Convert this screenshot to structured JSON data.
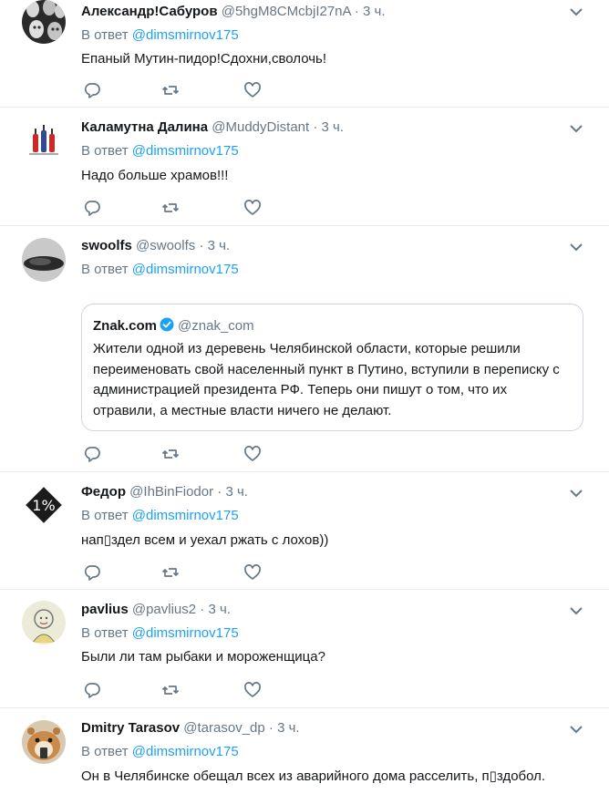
{
  "reply_prefix": "В ответ",
  "reply_target": "@dimsmirnov175",
  "colors": {
    "link": "#1da1f2",
    "secondary": "#657786",
    "border": "#e6ecf0",
    "verified": "#1da1f2"
  },
  "tweets": [
    {
      "name": "Александр!Сабуров",
      "handle": "@5hgM8CMcbjI27nA",
      "time": "3 ч.",
      "text": "Епаный Мутин-пидор!Сдохни,сволочь!"
    },
    {
      "name": "Каламутна Далина",
      "handle": "@MuddyDistant",
      "time": "3 ч.",
      "text": "Надо больше храмов!!!"
    },
    {
      "name": "swoolfs",
      "handle": "@swoolfs",
      "time": "3 ч.",
      "text": "",
      "quote": {
        "name": "Znak.com",
        "handle": "@znak_com",
        "verified": true,
        "text": "Жители одной из деревень Челябинской области, которые решили\nпереименовать свой населенный пункт в Путино, вступили в переписку с\nадминистрацией президента РФ. Теперь они пишут о том, что их\nотравили, а местные власти ничего не делают."
      }
    },
    {
      "name": "Федор",
      "handle": "@IhBinFiodor",
      "time": "3 ч.",
      "text": "нап▯здел всем и уехал ржать с лохов))"
    },
    {
      "name": "pavlius",
      "handle": "@pavlius2",
      "time": "3 ч.",
      "text": "Были ли там рыбаки и мороженщица?"
    },
    {
      "name": "Dmitry Tarasov",
      "handle": "@tarasov_dp",
      "time": "3 ч.",
      "text": "Он в Челябинске обещал всех из аварийного дома расселить, п▯здобол."
    }
  ],
  "icons": {
    "menu": "chevron-down-icon",
    "reply": "reply-icon",
    "retweet": "retweet-icon",
    "like": "like-icon",
    "verified": "verified-badge-icon"
  }
}
